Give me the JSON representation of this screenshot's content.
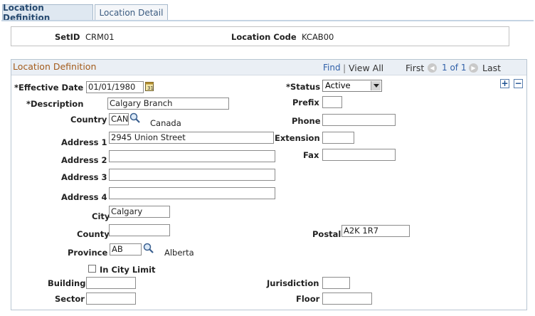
{
  "tabs": [
    {
      "label": "Location Definition",
      "active": true
    },
    {
      "label": "Location Detail",
      "active": false
    }
  ],
  "keys": {
    "setid_label": "SetID",
    "setid_value": "CRM01",
    "location_code_label": "Location Code",
    "location_code_value": "KCAB00"
  },
  "section": {
    "title": "Location Definition",
    "find": "Find",
    "separator": "|",
    "view_all": "View All",
    "first": "First",
    "page_count": "1 of 1",
    "last": "Last"
  },
  "form": {
    "effective_date_label": "*Effective Date",
    "effective_date_value": "01/01/1980",
    "description_label": "*Description",
    "description_value": "Calgary Branch",
    "country_label": "Country",
    "country_value": "CAN",
    "country_name": "Canada",
    "address1_label": "Address 1",
    "address1_value": "2945 Union Street",
    "address2_label": "Address 2",
    "address3_label": "Address 3",
    "address4_label": "Address 4",
    "city_label": "City",
    "city_value": "Calgary",
    "county_label": "County",
    "province_label": "Province",
    "province_value": "AB",
    "province_name": "Alberta",
    "in_city_limit_label": "In City Limit",
    "building_label": "Building",
    "sector_label": "Sector",
    "status_label": "*Status",
    "status_value": "Active",
    "prefix_label": "Prefix",
    "phone_label": "Phone",
    "extension_label": "Extension",
    "fax_label": "Fax",
    "postal_label": "Postal",
    "postal_value": "A2K 1R7",
    "jurisdiction_label": "Jurisdiction",
    "floor_label": "Floor"
  },
  "colors": {
    "section_title": "#a35b1b",
    "link": "#2f5fa8",
    "tab_active_bg": "#dfe8f1"
  },
  "icons": {
    "calendar": "calendar-icon",
    "lookup": "magnifier-icon",
    "add_row": "plus-icon",
    "delete_row": "minus-icon",
    "prev": "chevron-left-icon",
    "next": "chevron-right-icon"
  }
}
